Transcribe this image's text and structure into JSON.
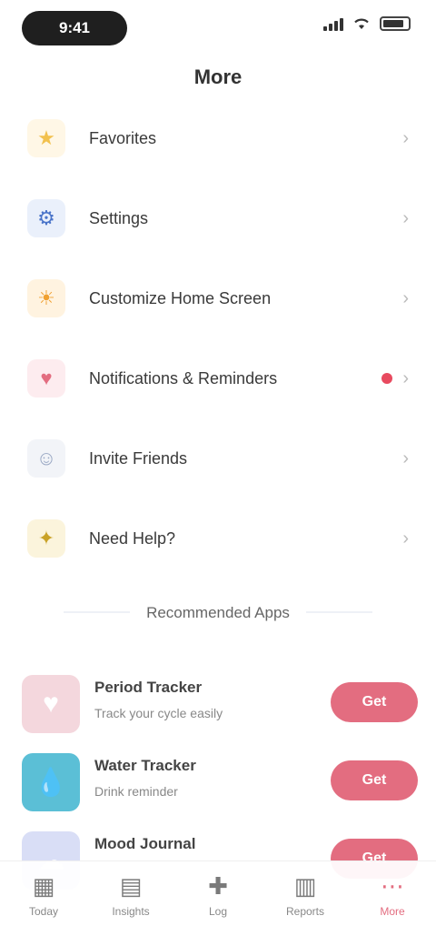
{
  "status_bar": {
    "time": "9:41"
  },
  "header": {
    "title": "More"
  },
  "menu": {
    "items": [
      {
        "label": "Favorites",
        "icon": "star-icon",
        "icon_glyph": "★",
        "icon_color": "#f2c14e",
        "icon_bg": "#fff7e6",
        "badge": false
      },
      {
        "label": "Settings",
        "icon": "gear-icon",
        "icon_glyph": "⚙",
        "icon_color": "#4a74c9",
        "icon_bg": "#eaf0fb",
        "badge": false
      },
      {
        "label": "Customize Home Screen",
        "icon": "sun-icon",
        "icon_glyph": "☀",
        "icon_color": "#f0a030",
        "icon_bg": "#fff3e0",
        "badge": false
      },
      {
        "label": "Notifications & Reminders",
        "icon": "bell-icon",
        "icon_glyph": "♥",
        "icon_color": "#e36d80",
        "icon_bg": "#fdecef",
        "badge": true
      },
      {
        "label": "Invite Friends",
        "icon": "person-icon",
        "icon_glyph": "☺",
        "icon_color": "#9aa8c4",
        "icon_bg": "#f2f4f8",
        "badge": false
      },
      {
        "label": "Need Help?",
        "icon": "lightbulb-icon",
        "icon_glyph": "✦",
        "icon_color": "#c9a227",
        "icon_bg": "#fbf4dc",
        "badge": false
      }
    ]
  },
  "section": {
    "label": "Recommended Apps"
  },
  "recommended": [
    {
      "title": "Period Tracker",
      "subtitle": "Track your cycle easily",
      "thumb_glyph": "♥",
      "thumb_bg": "#f4d7dd",
      "button": "Get"
    },
    {
      "title": "Water Tracker",
      "subtitle": "Drink reminder",
      "thumb_glyph": "💧",
      "thumb_bg": "#5bbfd6",
      "button": "Get"
    },
    {
      "title": "Mood Journal",
      "subtitle": "",
      "thumb_glyph": "☁",
      "thumb_bg": "#d9def6",
      "button": "Get"
    }
  ],
  "tab_bar": {
    "tabs": [
      {
        "label": "Today",
        "icon": "calendar-icon",
        "glyph": "▦"
      },
      {
        "label": "Insights",
        "icon": "chart-icon",
        "glyph": "▤"
      },
      {
        "label": "Log",
        "icon": "plus-icon",
        "glyph": "✚"
      },
      {
        "label": "Reports",
        "icon": "document-icon",
        "glyph": "▥"
      },
      {
        "label": "More",
        "icon": "more-icon",
        "glyph": "⋯"
      }
    ],
    "active_index": 4,
    "accent_color": "#e36d80"
  }
}
